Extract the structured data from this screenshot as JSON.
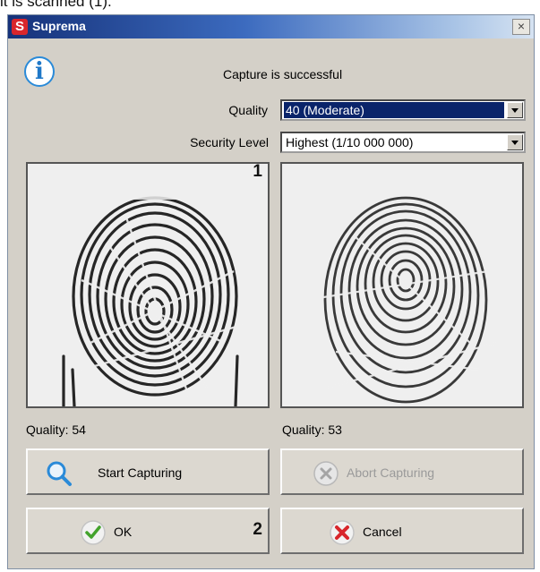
{
  "caption_text": "it is scanned (1).",
  "window": {
    "title": "Suprema",
    "app_icon_letter": "S",
    "close_symbol": "×"
  },
  "info_icon_glyph": "i",
  "status_text": "Capture is successful",
  "quality": {
    "label": "Quality",
    "selected": "40 (Moderate)"
  },
  "security": {
    "label": "Security Level",
    "selected": "Highest (1/10 000 000)"
  },
  "scans": [
    {
      "marker": "1",
      "quality_text": "Quality: 54"
    },
    {
      "marker": "",
      "quality_text": "Quality: 53"
    }
  ],
  "buttons": {
    "start_capturing": "Start Capturing",
    "abort_capturing": "Abort Capturing",
    "ok": "OK",
    "cancel": "Cancel"
  },
  "annotation_marker_2": "2",
  "colors": {
    "titlebar_start": "#16327a",
    "info_blue": "#2a8ad8",
    "ok_green": "#43a32d",
    "cancel_red": "#d8262c",
    "selection": "#0a246a"
  }
}
